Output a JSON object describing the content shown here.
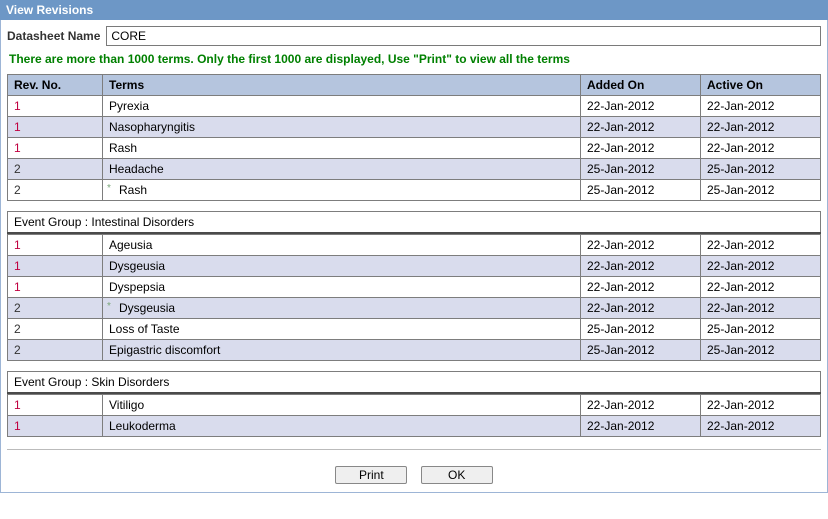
{
  "window": {
    "title": "View Revisions"
  },
  "form": {
    "datasheet_label": "Datasheet Name",
    "datasheet_value": "CORE",
    "warning": "There are more than 1000 terms. Only the first 1000 are displayed, Use \"Print\" to view all the terms"
  },
  "columns": {
    "rev": "Rev. No.",
    "terms": "Terms",
    "added": "Added On",
    "active": "Active On"
  },
  "groups": [
    {
      "label": null,
      "rows": [
        {
          "rev": "1",
          "term": "Pyrexia",
          "star": false,
          "added": "22-Jan-2012",
          "active": "22-Jan-2012",
          "shade": "r1"
        },
        {
          "rev": "1",
          "term": "Nasopharyngitis",
          "star": false,
          "added": "22-Jan-2012",
          "active": "22-Jan-2012",
          "shade": "r2"
        },
        {
          "rev": "1",
          "term": "Rash",
          "star": false,
          "added": "22-Jan-2012",
          "active": "22-Jan-2012",
          "shade": "r1"
        },
        {
          "rev": "2",
          "term": "Headache",
          "star": false,
          "added": "25-Jan-2012",
          "active": "25-Jan-2012",
          "shade": "r2"
        },
        {
          "rev": "2",
          "term": "Rash",
          "star": true,
          "added": "25-Jan-2012",
          "active": "25-Jan-2012",
          "shade": "r1"
        }
      ]
    },
    {
      "label": "Event Group :  Intestinal Disorders",
      "rows": [
        {
          "rev": "1",
          "term": "Ageusia",
          "star": false,
          "added": "22-Jan-2012",
          "active": "22-Jan-2012",
          "shade": "r1"
        },
        {
          "rev": "1",
          "term": "Dysgeusia",
          "star": false,
          "added": "22-Jan-2012",
          "active": "22-Jan-2012",
          "shade": "r2"
        },
        {
          "rev": "1",
          "term": "Dyspepsia",
          "star": false,
          "added": "22-Jan-2012",
          "active": "22-Jan-2012",
          "shade": "r1"
        },
        {
          "rev": "2",
          "term": "Dysgeusia",
          "star": true,
          "added": "22-Jan-2012",
          "active": "22-Jan-2012",
          "shade": "r2"
        },
        {
          "rev": "2",
          "term": "Loss of Taste",
          "star": false,
          "added": "25-Jan-2012",
          "active": "25-Jan-2012",
          "shade": "r1"
        },
        {
          "rev": "2",
          "term": "Epigastric discomfort",
          "star": false,
          "added": "25-Jan-2012",
          "active": "25-Jan-2012",
          "shade": "r2"
        }
      ]
    },
    {
      "label": "Event Group :   Skin Disorders",
      "rows": [
        {
          "rev": "1",
          "term": "Vitiligo",
          "star": false,
          "added": "22-Jan-2012",
          "active": "22-Jan-2012",
          "shade": "r1"
        },
        {
          "rev": "1",
          "term": "Leukoderma",
          "star": false,
          "added": "22-Jan-2012",
          "active": "22-Jan-2012",
          "shade": "r2"
        }
      ]
    }
  ],
  "buttons": {
    "print": "Print",
    "ok": "OK"
  }
}
